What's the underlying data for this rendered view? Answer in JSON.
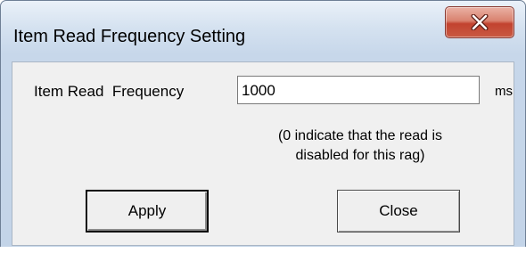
{
  "window": {
    "title": "Item Read Frequency Setting",
    "close_icon": "close-icon"
  },
  "form": {
    "frequency_label": "Item Read  Frequency",
    "frequency_value": "1000",
    "unit": "ms",
    "hint_line1": "(0 indicate that the read is",
    "hint_line2": "disabled for this rag)"
  },
  "buttons": {
    "apply_label": "Apply",
    "close_label": "Close"
  },
  "colors": {
    "titlebar": "#d5e2f0",
    "close_button": "#c2432f",
    "client": "#f0f0f0"
  }
}
